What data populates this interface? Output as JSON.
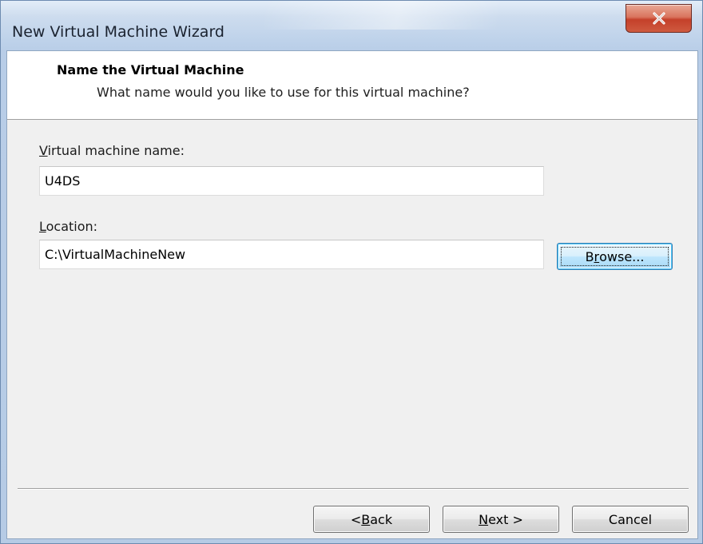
{
  "window": {
    "title": "New Virtual Machine Wizard"
  },
  "header": {
    "title": "Name the Virtual Machine",
    "subtitle": "What name would you like to use for this virtual machine?"
  },
  "form": {
    "vm_name_label_mnemonic": "V",
    "vm_name_label_rest": "irtual machine name:",
    "vm_name_value": "U4DS",
    "location_label_mnemonic": "L",
    "location_label_rest": "ocation:",
    "location_value": "C:\\VirtualMachineNew",
    "browse_pre": "B",
    "browse_mnemonic": "r",
    "browse_rest": "owse..."
  },
  "footer": {
    "back_pre": "< ",
    "back_mnemonic": "B",
    "back_rest": "ack",
    "next_mnemonic": "N",
    "next_rest": "ext >",
    "cancel_label": "Cancel"
  },
  "colors": {
    "close_button": "#c4402a",
    "focus_button_border": "#3c7fb1"
  }
}
